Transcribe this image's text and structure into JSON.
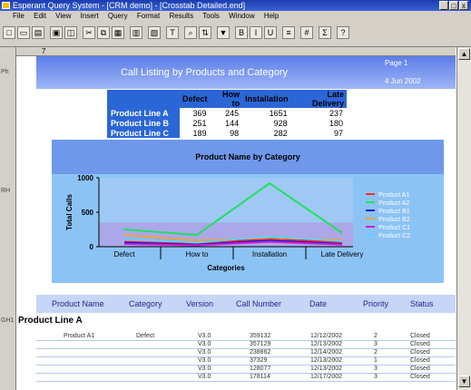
{
  "window": {
    "title": "Esperant Query System - [CRM demo] - [Crosstab Detailed.end]",
    "minimize": "_",
    "restore": "□",
    "close": "x"
  },
  "menu": [
    "File",
    "Edit",
    "View",
    "Insert",
    "Query",
    "Format",
    "Results",
    "Tools",
    "Window",
    "Help"
  ],
  "report": {
    "section_top": "7",
    "title": "Call Listing by Products and Category",
    "page_label": "Page 1",
    "date": "4 Jun 2002",
    "section_ph": "Ph",
    "section_rh": "RH",
    "section_gh": "GH1"
  },
  "summary": {
    "headers": [
      "",
      "Defect",
      "How to",
      "Installation",
      "Late Delivery"
    ],
    "rows": [
      {
        "label": "Product Line A",
        "values": [
          "369",
          "245",
          "1651",
          "237"
        ]
      },
      {
        "label": "Product Line B",
        "values": [
          "251",
          "144",
          "928",
          "180"
        ]
      },
      {
        "label": "Product Line C",
        "values": [
          "189",
          "98",
          "282",
          "97"
        ]
      }
    ]
  },
  "chart_data": {
    "type": "line",
    "title": "Product Name by Category",
    "xlabel": "Categories",
    "ylabel": "Total Calls",
    "categories": [
      "Defect",
      "How to",
      "Installation",
      "Late Delivery"
    ],
    "ylim": [
      0,
      1000
    ],
    "yticks": [
      0,
      500,
      1000
    ],
    "legend_position": "right",
    "series": [
      {
        "name": "Product A1",
        "color": "#ff2a2a",
        "values": [
          70,
          40,
          120,
          60
        ]
      },
      {
        "name": "Product A2",
        "color": "#20e060",
        "values": [
          250,
          170,
          920,
          200
        ]
      },
      {
        "name": "Product B1",
        "color": "#1a1ad0",
        "values": [
          60,
          30,
          90,
          40
        ]
      },
      {
        "name": "Product B2",
        "color": "#f0a040",
        "values": [
          170,
          90,
          130,
          100
        ]
      },
      {
        "name": "Product C1",
        "color": "#d020d0",
        "values": [
          40,
          20,
          70,
          30
        ]
      },
      {
        "name": "Product C2",
        "color": "#60d0ff",
        "values": [
          120,
          60,
          150,
          80
        ]
      }
    ]
  },
  "columns": [
    "Product Name",
    "Category",
    "Version",
    "Call Number",
    "Date",
    "Priority",
    "Status"
  ],
  "group_label": "Product Line A",
  "detail_rows": [
    {
      "product": "Product A1",
      "category": "Defect",
      "version": "V3.0",
      "call": "359132",
      "date": "12/12/2002",
      "priority": "2",
      "status": "Closed"
    },
    {
      "product": "",
      "category": "",
      "version": "V3.0",
      "call": "357129",
      "date": "12/13/2002",
      "priority": "3",
      "status": "Closed"
    },
    {
      "product": "",
      "category": "",
      "version": "V3.0",
      "call": "238862",
      "date": "12/14/2002",
      "priority": "2",
      "status": "Closed"
    },
    {
      "product": "",
      "category": "",
      "version": "V3.0",
      "call": "37329",
      "date": "12/13/2002",
      "priority": "1",
      "status": "Closed"
    },
    {
      "product": "",
      "category": "",
      "version": "V3.0",
      "call": "128077",
      "date": "12/13/2002",
      "priority": "3",
      "status": "Closed"
    },
    {
      "product": "",
      "category": "",
      "version": "V3.0",
      "call": "178114",
      "date": "12/17/2002",
      "priority": "3",
      "status": "Closed"
    }
  ]
}
